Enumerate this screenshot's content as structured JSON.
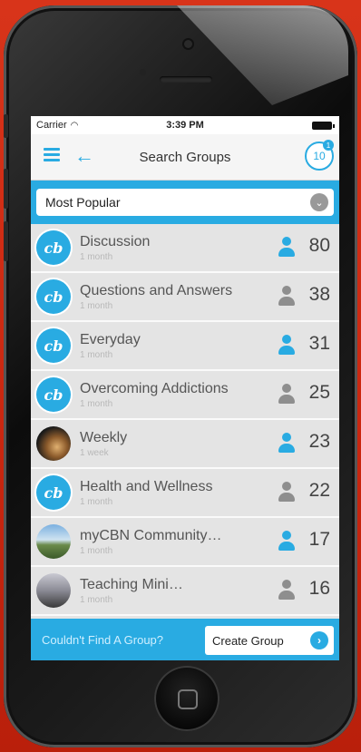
{
  "status_bar": {
    "carrier": "Carrier",
    "time": "3:39 PM"
  },
  "nav": {
    "title": "Search Groups",
    "notifications": "10",
    "badge": "1"
  },
  "filter": {
    "selected": "Most Popular"
  },
  "groups": [
    {
      "name": "Discussion",
      "sub": "1 month",
      "count": "80",
      "member_state": "blue",
      "avatar": "brand"
    },
    {
      "name": "Questions and Answers",
      "sub": "1 month",
      "count": "38",
      "member_state": "grey",
      "avatar": "brand"
    },
    {
      "name": "Everyday",
      "sub": "1 month",
      "count": "31",
      "member_state": "blue",
      "avatar": "brand"
    },
    {
      "name": "Overcoming Addictions",
      "sub": "1 month",
      "count": "25",
      "member_state": "grey",
      "avatar": "brand"
    },
    {
      "name": "Weekly",
      "sub": "1 week",
      "count": "23",
      "member_state": "blue",
      "avatar": "photo1"
    },
    {
      "name": "Health and Wellness",
      "sub": "1 month",
      "count": "22",
      "member_state": "grey",
      "avatar": "brand"
    },
    {
      "name": "myCBN Community…",
      "sub": "1 month",
      "count": "17",
      "member_state": "blue",
      "avatar": "photo2"
    },
    {
      "name": "Teaching Mini…",
      "sub": "1 month",
      "count": "16",
      "member_state": "grey",
      "avatar": "photo3"
    }
  ],
  "footer": {
    "prompt": "Couldn't Find A Group?",
    "button": "Create Group"
  },
  "colors": {
    "accent": "#29abe2",
    "background": "#d8341a"
  }
}
